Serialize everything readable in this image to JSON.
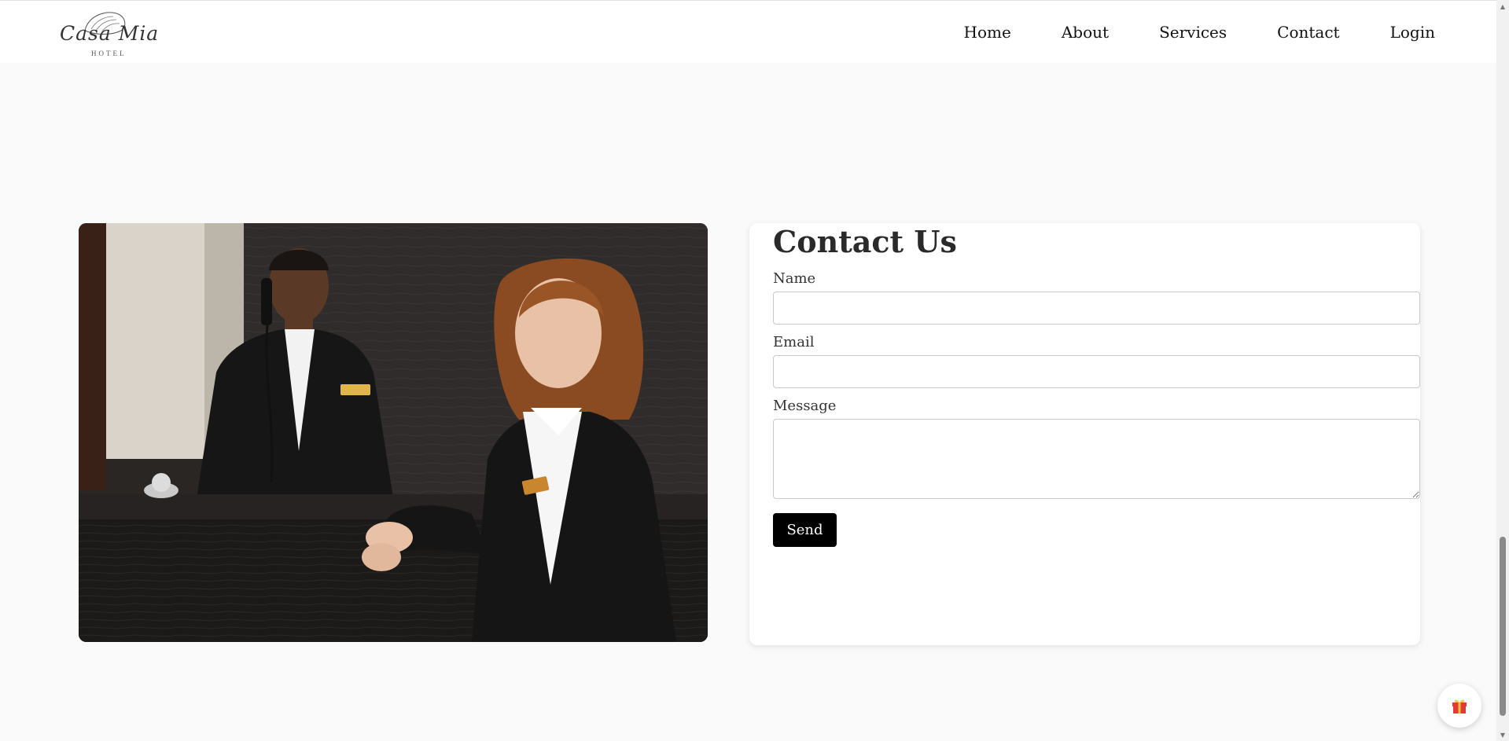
{
  "header": {
    "logo_text": "Casa Mia",
    "logo_sub": "HOTEL",
    "nav": [
      {
        "label": "Home"
      },
      {
        "label": "About"
      },
      {
        "label": "Services"
      },
      {
        "label": "Contact"
      },
      {
        "label": "Login"
      }
    ]
  },
  "contact": {
    "title": "Contact Us",
    "name_label": "Name",
    "name_value": "",
    "email_label": "Email",
    "email_value": "",
    "message_label": "Message",
    "message_value": "",
    "send_label": "Send"
  },
  "gift": {
    "icon": "gift-icon"
  },
  "colors": {
    "background": "#fafafa",
    "header_bg": "#ffffff",
    "button_bg": "#000000",
    "button_text": "#ffffff"
  }
}
